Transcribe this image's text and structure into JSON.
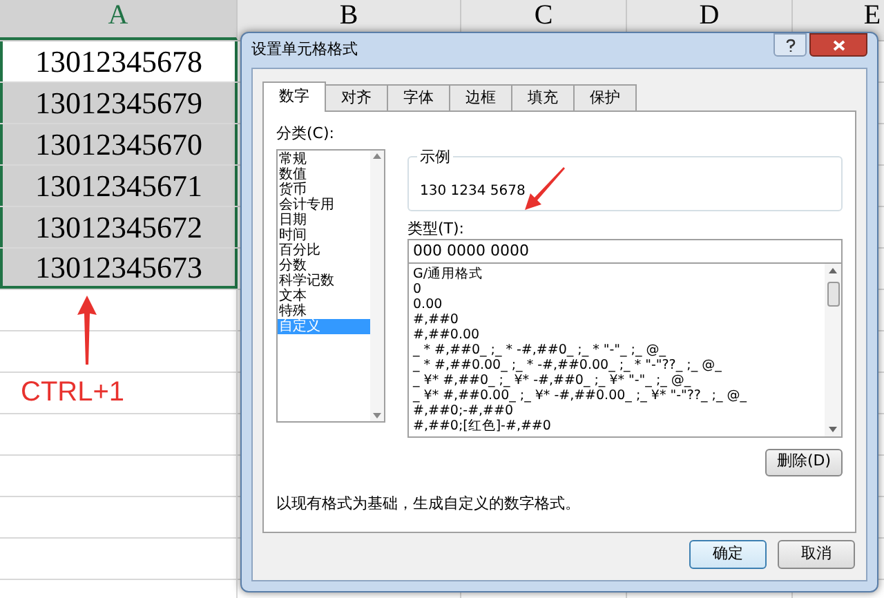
{
  "sheet": {
    "columns": [
      "A",
      "B",
      "C",
      "D",
      "E"
    ],
    "cells": [
      {
        "value": "13012345678",
        "highlighted": false
      },
      {
        "value": "13012345679",
        "highlighted": true
      },
      {
        "value": "13012345670",
        "highlighted": true
      },
      {
        "value": "13012345671",
        "highlighted": true
      },
      {
        "value": "13012345672",
        "highlighted": true
      },
      {
        "value": "13012345673",
        "highlighted": true
      }
    ]
  },
  "annotation": {
    "text": "CTRL+1"
  },
  "dialog": {
    "title": "设置单元格格式",
    "tabs": [
      {
        "label": "数字",
        "selected": true
      },
      {
        "label": "对齐",
        "selected": false
      },
      {
        "label": "字体",
        "selected": false
      },
      {
        "label": "边框",
        "selected": false
      },
      {
        "label": "填充",
        "selected": false
      },
      {
        "label": "保护",
        "selected": false
      }
    ],
    "category_label": "分类(C):",
    "categories": [
      {
        "label": "常规",
        "selected": false
      },
      {
        "label": "数值",
        "selected": false
      },
      {
        "label": "货币",
        "selected": false
      },
      {
        "label": "会计专用",
        "selected": false
      },
      {
        "label": "日期",
        "selected": false
      },
      {
        "label": "时间",
        "selected": false
      },
      {
        "label": "百分比",
        "selected": false
      },
      {
        "label": "分数",
        "selected": false
      },
      {
        "label": "科学记数",
        "selected": false
      },
      {
        "label": "文本",
        "selected": false
      },
      {
        "label": "特殊",
        "selected": false
      },
      {
        "label": "自定义",
        "selected": true
      }
    ],
    "sample_label": "示例",
    "sample_value": "130 1234 5678",
    "type_label": "类型(T):",
    "type_value": "000 0000 0000",
    "formats": [
      "G/通用格式",
      "0",
      "0.00",
      "#,##0",
      "#,##0.00",
      "_ * #,##0_ ;_ * -#,##0_ ;_ * \"-\"_ ;_ @_",
      "_ * #,##0.00_ ;_ * -#,##0.00_ ;_ * \"-\"??_ ;_ @_",
      "_ ¥* #,##0_ ;_ ¥* -#,##0_ ;_ ¥* \"-\"_ ;_ @_",
      "_ ¥* #,##0.00_ ;_ ¥* -#,##0.00_ ;_ ¥* \"-\"??_ ;_ @_",
      "#,##0;-#,##0",
      "#,##0;[红色]-#,##0"
    ],
    "delete_button": "删除(D)",
    "description": "以现有格式为基础，生成自定义的数字格式。",
    "ok_button": "确定",
    "cancel_button": "取消"
  }
}
